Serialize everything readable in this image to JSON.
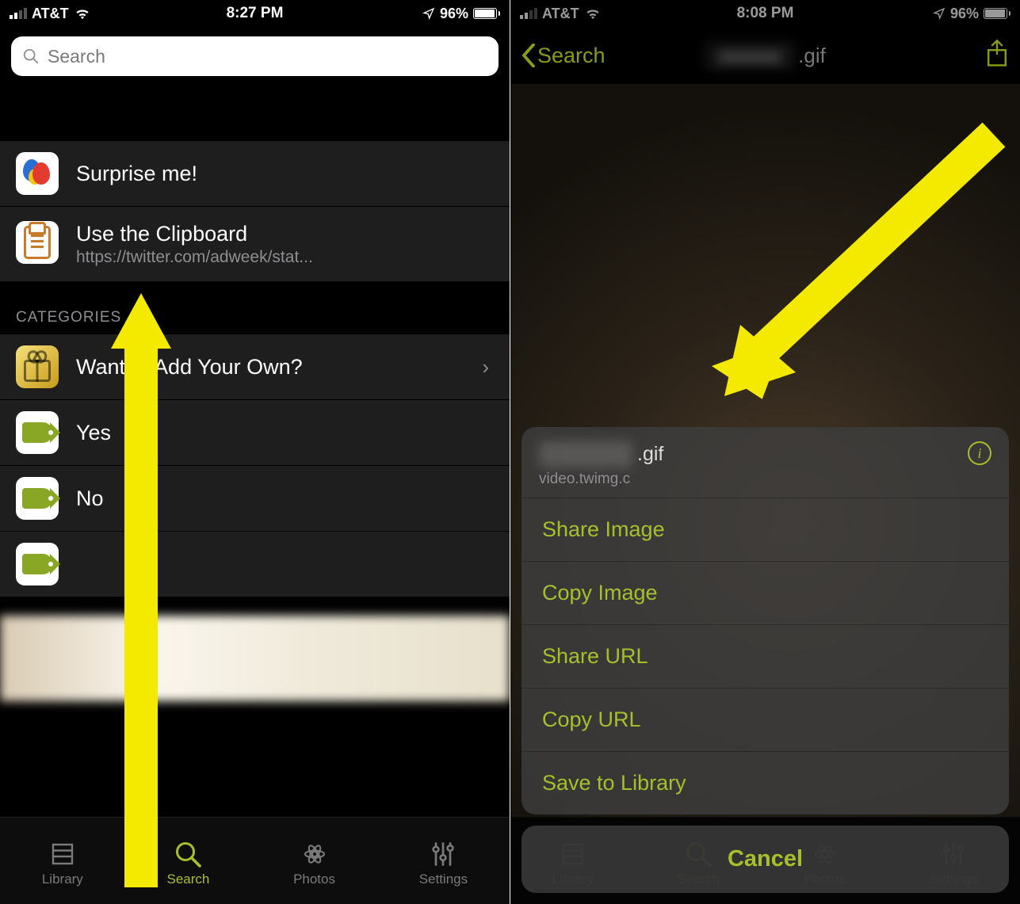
{
  "left": {
    "status": {
      "carrier": "AT&T",
      "time": "8:27 PM",
      "battery_pct": "96%"
    },
    "search_placeholder": "Search",
    "items": [
      {
        "title": "Surprise me!"
      },
      {
        "title": "Use the Clipboard",
        "sub": "https://twitter.com/adweek/stat..."
      }
    ],
    "section": "CATEGORIES",
    "categories": [
      {
        "title": "Want to Add Your Own?"
      },
      {
        "title": "Yes"
      },
      {
        "title": "No"
      }
    ],
    "tabs": [
      "Library",
      "Search",
      "Photos",
      "Settings"
    ],
    "active_tab": "Search"
  },
  "right": {
    "status": {
      "carrier": "AT&T",
      "time": "8:08 PM",
      "battery_pct": "96%"
    },
    "back": "Search",
    "title_ext": ".gif",
    "sheet": {
      "ext": ".gif",
      "host": "video.twimg.c",
      "actions": [
        "Share Image",
        "Copy Image",
        "Share URL",
        "Copy URL",
        "Save to Library"
      ],
      "cancel": "Cancel"
    },
    "tabs": [
      "Library",
      "Search",
      "Photos",
      "Settings"
    ],
    "active_tab": "Search"
  },
  "accent": "#a6c02c"
}
